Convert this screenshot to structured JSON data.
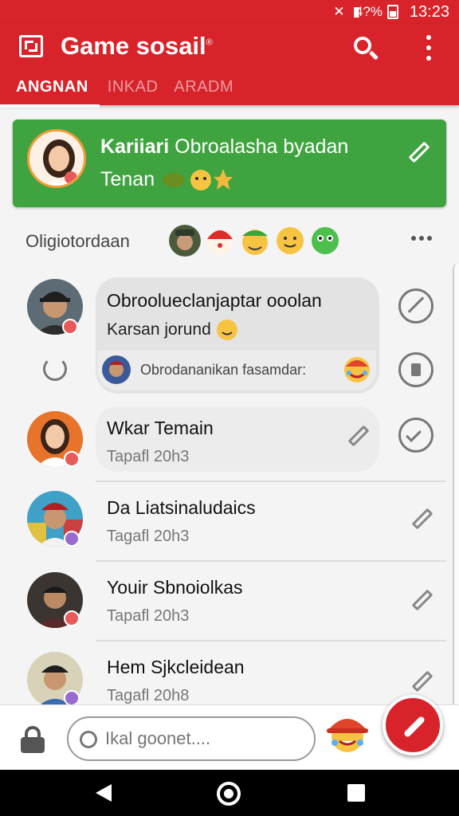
{
  "status_bar": {
    "battery": "4?%",
    "time": "13:23"
  },
  "app": {
    "title": "Game sosail",
    "title_mark": "®"
  },
  "tabs": [
    {
      "label": "ANGNAN",
      "active": true
    },
    {
      "label": "INKAD",
      "active": false
    },
    {
      "label": "ARADM",
      "active": false
    }
  ],
  "featured": {
    "name_bold": "Kariiari",
    "name_rest": "Obroalasha byadan",
    "status": "Tenan",
    "color": "#3fa33f"
  },
  "section": {
    "title": "Oligiotordaan"
  },
  "chats": [
    {
      "title": "Obroolueclanjaptar ooolan",
      "subtitle": "Karsan jorund",
      "reply_text": "Obrodananikan fasamdar:"
    },
    {
      "title": "Wkar Temain",
      "subtitle": "Tapafl 20h3"
    },
    {
      "title": "Da Liatsinaludaics",
      "subtitle": "Tagafl 20h3"
    },
    {
      "title": "Youir Sbnoiolkas",
      "subtitle": "Tapafl 20h3"
    },
    {
      "title": "Hem Sjkcleidean",
      "subtitle": "Tagafl 20h8"
    }
  ],
  "input": {
    "value": "",
    "placeholder": "Ikal goonet...."
  },
  "colors": {
    "brand": "#d8232a",
    "featured": "#3fa33f"
  }
}
